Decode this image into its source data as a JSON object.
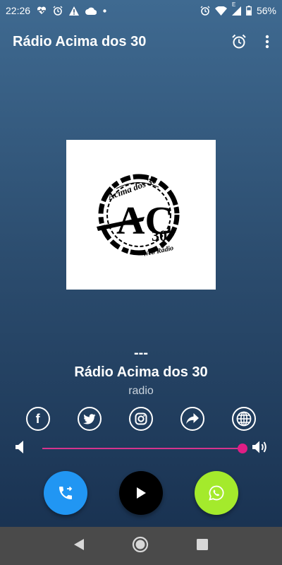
{
  "status": {
    "time": "22:26",
    "network_label": "E",
    "battery": "56%"
  },
  "app": {
    "title": "Rádio Acima dos 30",
    "actions": [
      "alarm-clock-icon",
      "more-vertical-icon"
    ]
  },
  "artwork": {
    "logo_text": "Acima dos 30",
    "logo_letters": "AC",
    "logo_number": "30",
    "logo_tagline": "Web Rádio"
  },
  "now_playing": {
    "track": "---",
    "station": "Rádio Acima dos 30",
    "subtitle": "radio"
  },
  "social": [
    {
      "icon": "facebook-icon",
      "glyph": "f"
    },
    {
      "icon": "twitter-icon"
    },
    {
      "icon": "instagram-icon"
    },
    {
      "icon": "share-icon"
    },
    {
      "icon": "globe-icon"
    }
  ],
  "volume": {
    "level": 1.0,
    "accent": "#e01e85"
  },
  "controls": {
    "call": {
      "icon": "phone-forward-icon",
      "color": "#2196f3"
    },
    "play": {
      "icon": "play-icon",
      "color": "#000000"
    },
    "whatsapp": {
      "icon": "whatsapp-icon",
      "color": "#a4ea2c"
    }
  },
  "nav": [
    "back-icon",
    "home-icon",
    "recents-icon"
  ]
}
